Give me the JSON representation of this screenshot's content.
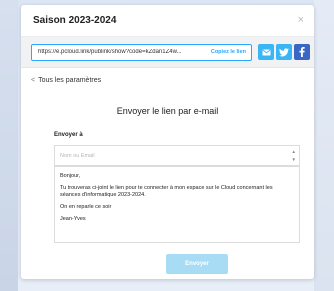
{
  "dialog": {
    "title": "Saison 2023-2024",
    "close_glyph": "×"
  },
  "share": {
    "url": "https://e.pcloud.link/publink/show?code=kZdan1Z4w...",
    "copy_label": "Copiez le lien",
    "buttons": [
      {
        "icon": "email-icon",
        "color": "#3ab5f5"
      },
      {
        "icon": "twitter-icon",
        "color": "#3ab5f5"
      },
      {
        "icon": "facebook-icon",
        "color": "#3b66c4"
      }
    ]
  },
  "nav": {
    "back_glyph": "<",
    "back_label": "Tous les paramètres"
  },
  "email_form": {
    "heading": "Envoyer le lien par e-mail",
    "to_label": "Envoyer à",
    "to_placeholder": "Nom ou Email",
    "message_lines": [
      "Bonjour,",
      "Tu trouveras ci-joint le lien pour te connecter à mon espace sur le Cloud concernant les séances d'informatique 2023-2024.",
      "On en reparle ce soir",
      "Jean-Yves"
    ],
    "send_label": "Envoyer"
  }
}
